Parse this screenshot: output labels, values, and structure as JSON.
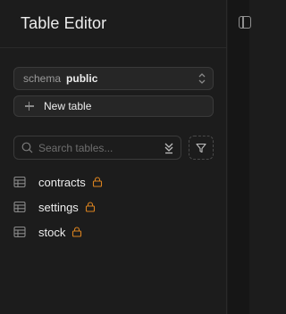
{
  "header": {
    "title": "Table Editor"
  },
  "schema": {
    "label": "schema",
    "value": "public"
  },
  "actions": {
    "new_table_label": "New table"
  },
  "search": {
    "placeholder": "Search tables..."
  },
  "tables": [
    {
      "name": "contracts",
      "locked": true
    },
    {
      "name": "settings",
      "locked": true
    },
    {
      "name": "stock",
      "locked": true
    }
  ],
  "colors": {
    "background": "#1c1c1c",
    "border": "#3a3a3a",
    "lock": "#d9821f",
    "muted": "#8a8a8a"
  },
  "icons": {
    "collapse": "panel-collapse-icon",
    "chevrons": "chevron-up-down-icon",
    "plus": "plus-icon",
    "search": "search-icon",
    "sort": "sort-icon",
    "filter": "filter-icon",
    "table": "table-icon",
    "lock": "lock-icon"
  }
}
